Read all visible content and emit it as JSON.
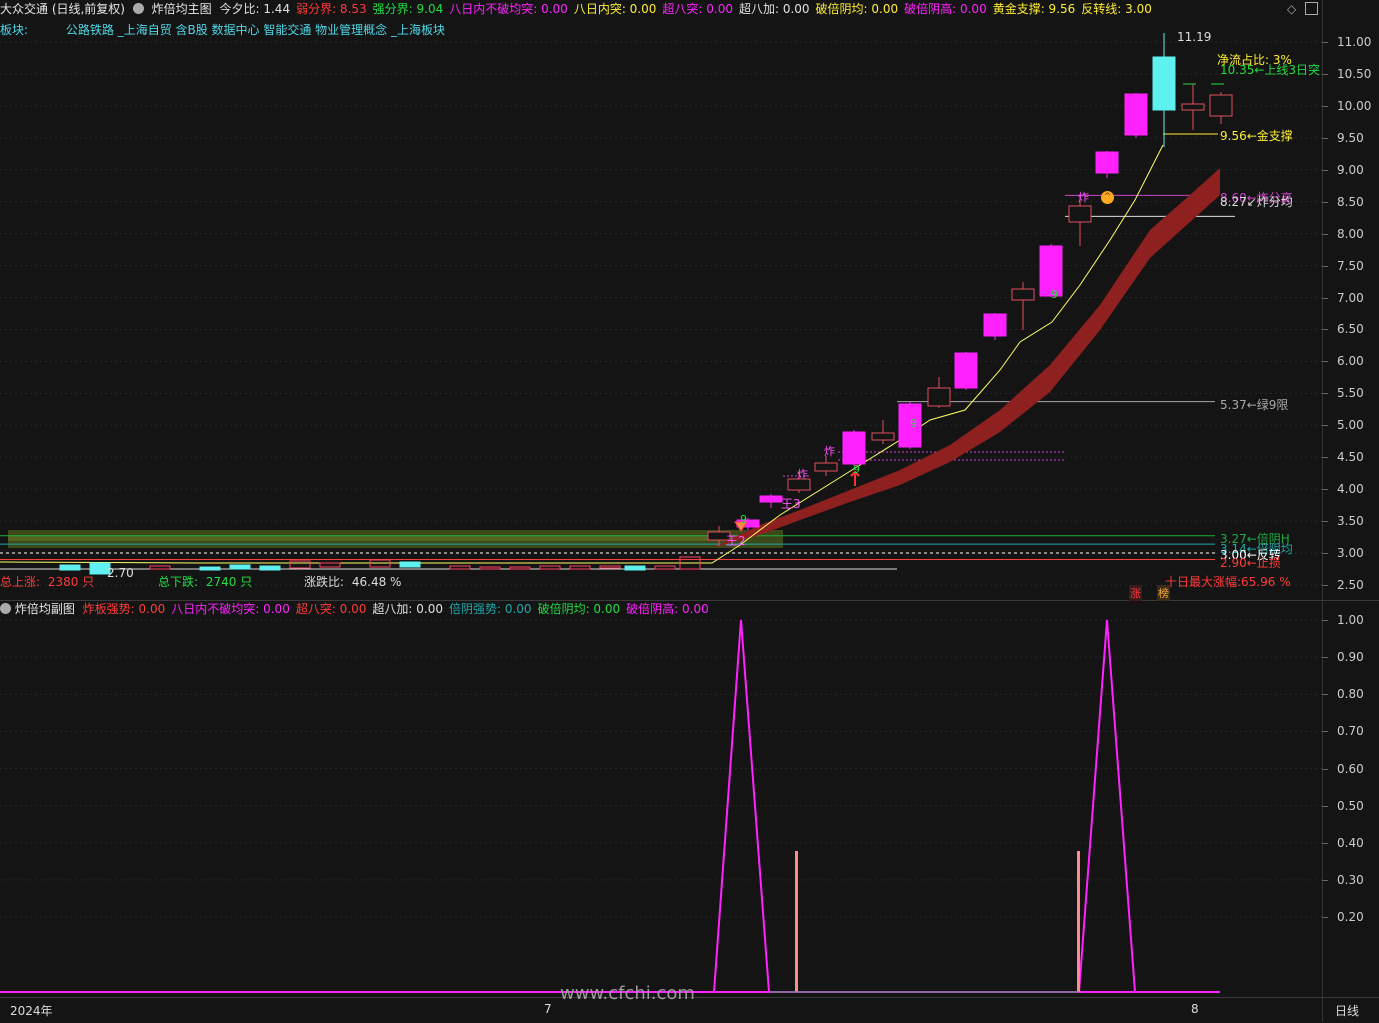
{
  "header": {
    "stock_title": "大众交通 (日线,前复权)",
    "indicator_name": "炸倍均主图",
    "items": [
      {
        "label": "今夕比: 1.44",
        "color": "#e0e0e0"
      },
      {
        "label": "弱分界: 8.53",
        "color": "#ff3b3b"
      },
      {
        "label": "强分界: 9.04",
        "color": "#22dd44"
      },
      {
        "label": "八日内不破均突: 0.00",
        "color": "#ff22ff"
      },
      {
        "label": "八日内突: 0.00",
        "color": "#ffee33"
      },
      {
        "label": "超八突: 0.00",
        "color": "#ff22ff"
      },
      {
        "label": "超八加: 0.00",
        "color": "#e0e0e0"
      },
      {
        "label": "破倍阴均: 0.00",
        "color": "#ffee33"
      },
      {
        "label": "破倍阴高: 0.00",
        "color": "#ff22ff"
      },
      {
        "label": "黄金支撑: 9.56",
        "color": "#ffee33"
      },
      {
        "label": "反转线: 3.00",
        "color": "#ffee33"
      }
    ]
  },
  "sectors": {
    "label": "板块:",
    "items": "公路铁路 _上海自贸 含B股 数据中心 智能交通 物业管理概念 _上海板块"
  },
  "price_axis": [
    "11.00",
    "10.50",
    "10.00",
    "9.50",
    "9.00",
    "8.50",
    "8.00",
    "7.50",
    "7.00",
    "6.50",
    "6.00",
    "5.50",
    "5.00",
    "4.50",
    "4.00",
    "3.50",
    "3.00",
    "2.50"
  ],
  "annotations": {
    "high_price": "11.19",
    "low_price": "2.70",
    "net_flow": "净流占比: 3%",
    "upper_line": "10.35←上线3日突",
    "gold_support": "9.56←金支撑",
    "zha_fen_gao": "8.60←炸分高",
    "zha_fen_jun": "8.27↙炸分均",
    "green9": "5.37←绿9限",
    "bei_yin_h": "3.27←倍阴H",
    "bei_yin_jun": "3.14←倍阴均",
    "fan_zhuan": "3.00←反转",
    "zhi_sun": "2.90←止损",
    "ten_day_max": "十日最大涨幅:65.96 %",
    "wang2": "王2",
    "wang3": "王3",
    "zha": "炸",
    "nine": "9",
    "zhang": "涨",
    "bang": "榜"
  },
  "stats": {
    "up_label": "总上涨:",
    "up_value": "2380 只",
    "down_label": "总下跌:",
    "down_value": "2740 只",
    "ratio_label": "涨跌比:",
    "ratio_value": "46.48 %"
  },
  "sub_header": {
    "name": "炸倍均副图",
    "items": [
      {
        "label": "炸板强势: 0.00",
        "color": "#ff3b3b"
      },
      {
        "label": "八日内不破均突: 0.00",
        "color": "#ff22ff"
      },
      {
        "label": "超八突: 0.00",
        "color": "#ff3b3b"
      },
      {
        "label": "超八加: 0.00",
        "color": "#e0e0e0"
      },
      {
        "label": "倍阴强势: 0.00",
        "color": "#1fa8a8"
      },
      {
        "label": "破倍阴均: 0.00",
        "color": "#22dd44"
      },
      {
        "label": "破倍阴高: 0.00",
        "color": "#ff22ff"
      }
    ]
  },
  "sub_axis": [
    "1.00",
    "0.90",
    "0.80",
    "0.70",
    "0.60",
    "0.50",
    "0.40",
    "0.30",
    "0.20"
  ],
  "time_axis": {
    "year": "2024年",
    "m7": "7",
    "m8": "8",
    "period": "日线"
  },
  "watermark": "www.cfchi.com",
  "colors": {
    "bg": "#141414",
    "up": "#ff22ff",
    "upline": "#e05060",
    "limit": "#5ff0f0",
    "band": "#8e2020",
    "ma": "#ffff66"
  }
}
